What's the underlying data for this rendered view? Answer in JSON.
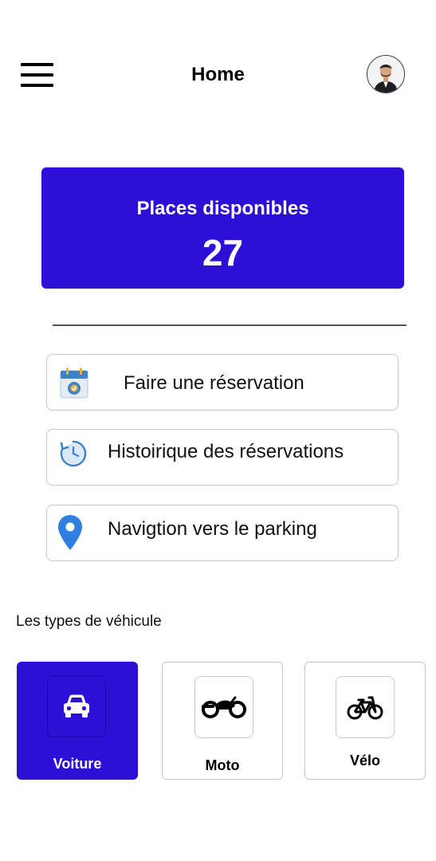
{
  "header": {
    "title": "Home",
    "menu_icon": "hamburger-menu-icon",
    "avatar_icon": "user-avatar"
  },
  "availability": {
    "label": "Places disponibles",
    "count": "27",
    "color": "#2d0fd8"
  },
  "actions": [
    {
      "label": "Faire une réservation",
      "icon": "calendar-icon"
    },
    {
      "label": "Histoirique des réservations",
      "icon": "history-clock-icon"
    },
    {
      "label": "Navigtion vers le parking",
      "icon": "location-pin-icon"
    }
  ],
  "vehicle_types": {
    "title": "Les types de véhicule",
    "items": [
      {
        "label": "Voiture",
        "icon": "car-icon",
        "selected": true
      },
      {
        "label": "Moto",
        "icon": "motorcycle-icon",
        "selected": false
      },
      {
        "label": "Vélo",
        "icon": "bicycle-icon",
        "selected": false
      }
    ]
  }
}
